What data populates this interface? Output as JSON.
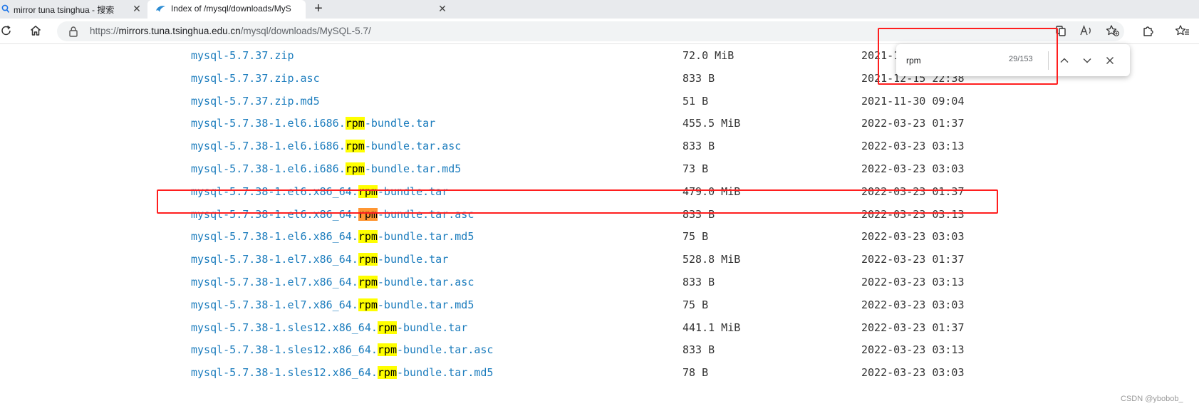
{
  "browser": {
    "tabs": [
      {
        "title": "mirror tuna tsinghua - 搜索",
        "icon": "search-icon",
        "active": false
      },
      {
        "title": "Index of /mysql/downloads/MyS",
        "icon": "tsinghua-logo-icon",
        "active": true
      }
    ],
    "url": {
      "scheme": "https://",
      "host": "mirrors.tuna.tsinghua.edu.cn",
      "path": "/mysql/downloads/MySQL-5.7/"
    },
    "toolbar_icons": [
      "refresh-icon",
      "home-icon",
      "lock-icon",
      "page-translate-icon",
      "read-aloud-icon",
      "add-favorite-icon",
      "extensions-icon",
      "favorites-icon"
    ]
  },
  "find_bar": {
    "query": "rpm",
    "count": "29/153",
    "buttons": [
      "previous-match",
      "next-match",
      "close"
    ]
  },
  "highlight_term": "rpm",
  "listing": [
    {
      "name": "mysql-5.7.37.zip",
      "size": "72.0 MiB",
      "date": "2021-12-15 22:38"
    },
    {
      "name": "mysql-5.7.37.zip.asc",
      "size": "833 B",
      "date": "2021-12-15 22:38"
    },
    {
      "name": "mysql-5.7.37.zip.md5",
      "size": "51 B",
      "date": "2021-11-30 09:04"
    },
    {
      "name": "mysql-5.7.38-1.el6.i686.rpm-bundle.tar",
      "size": "455.5 MiB",
      "date": "2022-03-23 01:37"
    },
    {
      "name": "mysql-5.7.38-1.el6.i686.rpm-bundle.tar.asc",
      "size": "833 B",
      "date": "2022-03-23 03:13"
    },
    {
      "name": "mysql-5.7.38-1.el6.i686.rpm-bundle.tar.md5",
      "size": "73 B",
      "date": "2022-03-23 03:03"
    },
    {
      "name": "mysql-5.7.38-1.el6.x86_64.rpm-bundle.tar",
      "size": "479.0 MiB",
      "date": "2022-03-23 01:37",
      "annotated": true
    },
    {
      "name": "mysql-5.7.38-1.el6.x86_64.rpm-bundle.tar.asc",
      "size": "833 B",
      "date": "2022-03-23 03:13",
      "current_match": true
    },
    {
      "name": "mysql-5.7.38-1.el6.x86_64.rpm-bundle.tar.md5",
      "size": "75 B",
      "date": "2022-03-23 03:03"
    },
    {
      "name": "mysql-5.7.38-1.el7.x86_64.rpm-bundle.tar",
      "size": "528.8 MiB",
      "date": "2022-03-23 01:37"
    },
    {
      "name": "mysql-5.7.38-1.el7.x86_64.rpm-bundle.tar.asc",
      "size": "833 B",
      "date": "2022-03-23 03:13"
    },
    {
      "name": "mysql-5.7.38-1.el7.x86_64.rpm-bundle.tar.md5",
      "size": "75 B",
      "date": "2022-03-23 03:03"
    },
    {
      "name": "mysql-5.7.38-1.sles12.x86_64.rpm-bundle.tar",
      "size": "441.1 MiB",
      "date": "2022-03-23 01:37"
    },
    {
      "name": "mysql-5.7.38-1.sles12.x86_64.rpm-bundle.tar.asc",
      "size": "833 B",
      "date": "2022-03-23 03:13"
    },
    {
      "name": "mysql-5.7.38-1.sles12.x86_64.rpm-bundle.tar.md5",
      "size": "78 B",
      "date": "2022-03-23 03:03"
    }
  ],
  "colors": {
    "link": "#1b7cbd",
    "match_highlight": "#ffff00",
    "current_match_highlight": "#ff9632",
    "annotation_red": "#ff1e1e"
  },
  "watermark": "CSDN @ybobob_"
}
